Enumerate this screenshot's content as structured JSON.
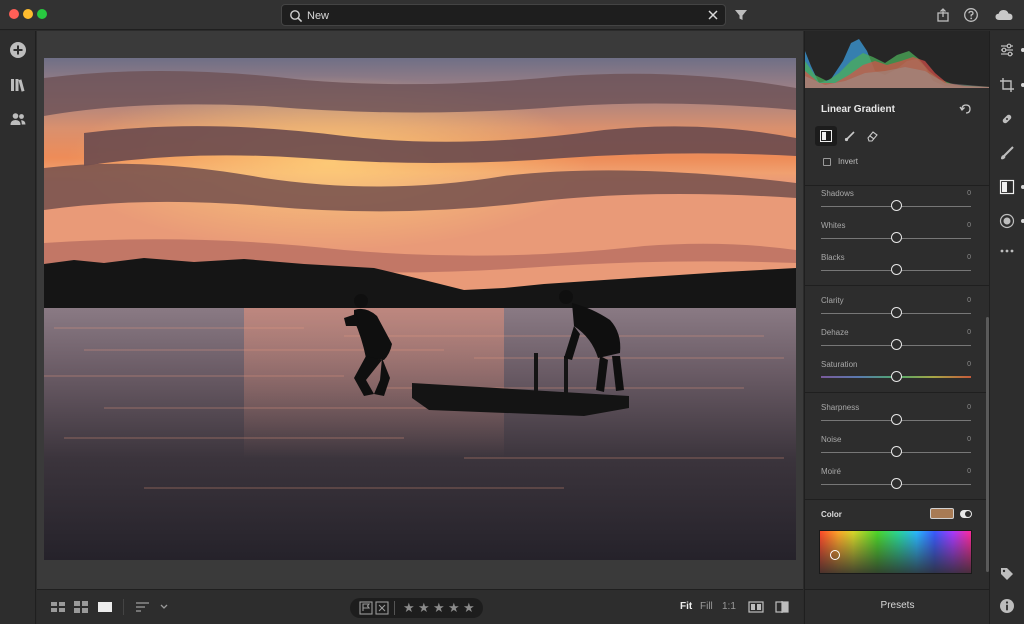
{
  "search": {
    "value": "New",
    "placeholder": ""
  },
  "panel": {
    "title": "Linear Gradient",
    "invert_label": "Invert",
    "sliders": [
      {
        "label": "Shadows",
        "value": "0"
      },
      {
        "label": "Whites",
        "value": "0"
      },
      {
        "label": "Blacks",
        "value": "0"
      },
      {
        "label": "Clarity",
        "value": "0"
      },
      {
        "label": "Dehaze",
        "value": "0"
      },
      {
        "label": "Saturation",
        "value": "0"
      },
      {
        "label": "Sharpness",
        "value": "0"
      },
      {
        "label": "Noise",
        "value": "0"
      },
      {
        "label": "Moiré",
        "value": "0"
      }
    ],
    "color_label": "Color",
    "color_swatch": "#a87b55",
    "presets_label": "Presets"
  },
  "bottom": {
    "zoom_fit": "Fit",
    "zoom_fill": "Fill",
    "zoom_1to1": "1:1",
    "stars": [
      "★",
      "★",
      "★",
      "★",
      "★"
    ]
  },
  "colors": {
    "accent": "#e6e6e6",
    "background": "#2b2b2b"
  },
  "icons": {
    "left": [
      "add-icon",
      "library-icon",
      "people-icon"
    ],
    "right": [
      "edit-sliders-icon",
      "crop-icon",
      "healing-icon",
      "brush-icon",
      "linear-gradient-icon",
      "radial-gradient-icon",
      "more-icon",
      "tag-icon",
      "info-icon"
    ]
  }
}
